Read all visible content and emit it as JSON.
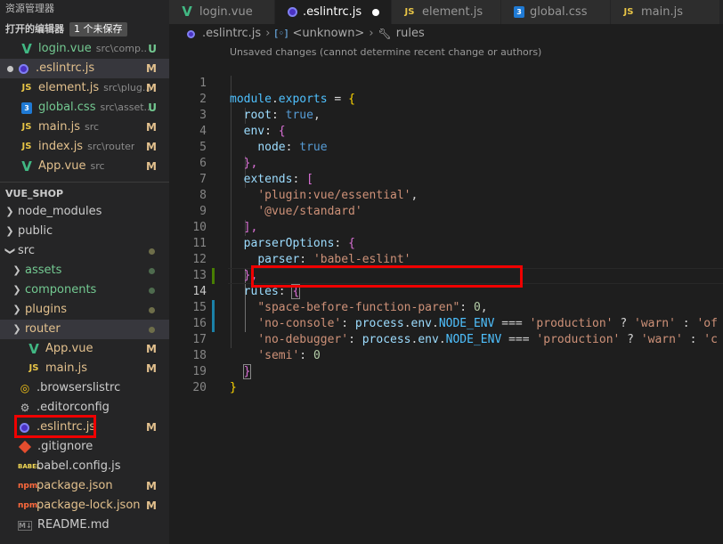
{
  "sidebar": {
    "title": "资源管理器",
    "open_editors": {
      "label": "打开的编辑器",
      "badge": "1 个未保存",
      "items": [
        {
          "icon": "vue-file-icon",
          "name": "login.vue",
          "desc": "src\\comp...",
          "status": "U"
        },
        {
          "icon": "eslint-file-icon",
          "name": ".eslintrc.js",
          "desc": "",
          "status": "M"
        },
        {
          "icon": "js-file-icon",
          "name": "element.js",
          "desc": "src\\plug...",
          "status": "M"
        },
        {
          "icon": "css-file-icon",
          "name": "global.css",
          "desc": "src\\asset...",
          "status": "U"
        },
        {
          "icon": "js-file-icon",
          "name": "main.js",
          "desc": "src",
          "status": "M"
        },
        {
          "icon": "js-file-icon",
          "name": "index.js",
          "desc": "src\\router",
          "status": "M"
        },
        {
          "icon": "vue-file-icon",
          "name": "App.vue",
          "desc": "src",
          "status": "M"
        }
      ]
    },
    "project": {
      "label": "VUE_SHOP",
      "items": [
        {
          "name": "node_modules"
        },
        {
          "name": "public"
        },
        {
          "name": "src"
        },
        {
          "name": "assets"
        },
        {
          "name": "components"
        },
        {
          "name": "plugins"
        },
        {
          "name": "router"
        },
        {
          "name": "App.vue",
          "status": "M"
        },
        {
          "name": "main.js",
          "status": "M"
        },
        {
          "name": ".browserslistrc"
        },
        {
          "name": ".editorconfig"
        },
        {
          "name": ".eslintrc.js",
          "status": "M"
        },
        {
          "name": ".gitignore"
        },
        {
          "name": "babel.config.js"
        },
        {
          "name": "package.json",
          "status": "M"
        },
        {
          "name": "package-lock.json",
          "status": "M"
        },
        {
          "name": "README.md"
        }
      ]
    }
  },
  "tabs": [
    {
      "label": "login.vue",
      "icon": "vue-file-icon"
    },
    {
      "label": ".eslintrc.js",
      "icon": "eslint-file-icon",
      "active": true,
      "unsaved": true
    },
    {
      "label": "element.js",
      "icon": "js-file-icon"
    },
    {
      "label": "global.css",
      "icon": "css-file-icon"
    },
    {
      "label": "main.js",
      "icon": "js-file-icon"
    }
  ],
  "breadcrumb": {
    "file": ".eslintrc.js",
    "object": "<unknown>",
    "property": "rules"
  },
  "editor": {
    "codelens": "Unsaved changes (cannot determine recent change or authors)",
    "line_numbers": [
      "1",
      "2",
      "3",
      "4",
      "5",
      "6",
      "7",
      "8",
      "9",
      "10",
      "11",
      "12",
      "13",
      "14",
      "15",
      "16",
      "17",
      "18",
      "19",
      "20"
    ],
    "current_line": "14",
    "code": {
      "l1_module": "module",
      "l1_dot": ".",
      "l1_exports": "exports",
      "l1_eq": " = ",
      "l1_brace": "{",
      "l2_key": "root",
      "l2_colon": ": ",
      "l2_val": "true",
      "l2_comma": ",",
      "l3_key": "env",
      "l3_colon": ": ",
      "l3_brace": "{",
      "l4_key": "node",
      "l4_colon": ": ",
      "l4_val": "true",
      "l5_close": "},",
      "l6_key": "extends",
      "l6_colon": ": ",
      "l6_br": "[",
      "l7_str": "'plugin:vue/essential'",
      "l7_comma": ",",
      "l8_str": "'@vue/standard'",
      "l9_close": "],",
      "l10_key": "parserOptions",
      "l10_colon": ": ",
      "l10_brace": "{",
      "l11_key": "parser",
      "l11_colon": ": ",
      "l11_str": "'babel-eslint'",
      "l12_close": "},",
      "l13_key": "rules",
      "l13_colon": ": ",
      "l13_brace": "{",
      "l14_str": "\"space-before-function-paren\"",
      "l14_colon": ": ",
      "l14_num": "0",
      "l14_comma": ",",
      "l15_key": "'no-console'",
      "l15_colon": ": ",
      "l15_proc": "process",
      "l15_dot1": ".",
      "l15_env": "env",
      "l15_dot2": ".",
      "l15_const": "NODE_ENV",
      "l15_op": " === ",
      "l15_str": "'production'",
      "l15_q": " ? ",
      "l15_warn": "'warn'",
      "l15_c": " : ",
      "l15_off": "'of",
      "l16_key": "'no-debugger'",
      "l16_colon": ": ",
      "l16_proc": "process",
      "l16_dot1": ".",
      "l16_env": "env",
      "l16_dot2": ".",
      "l16_const": "NODE_ENV",
      "l16_op": " === ",
      "l16_str": "'production'",
      "l16_q": " ? ",
      "l16_warn": "'warn'",
      "l16_c": " : ",
      "l16_off": "'c",
      "l17_key": "'semi'",
      "l17_colon": ": ",
      "l17_num": "0",
      "l18_close": "}",
      "l19_close": "}"
    }
  },
  "colors": {
    "highlight_box": "#f00000",
    "modified": "#e2c08d",
    "untracked": "#73c991"
  }
}
